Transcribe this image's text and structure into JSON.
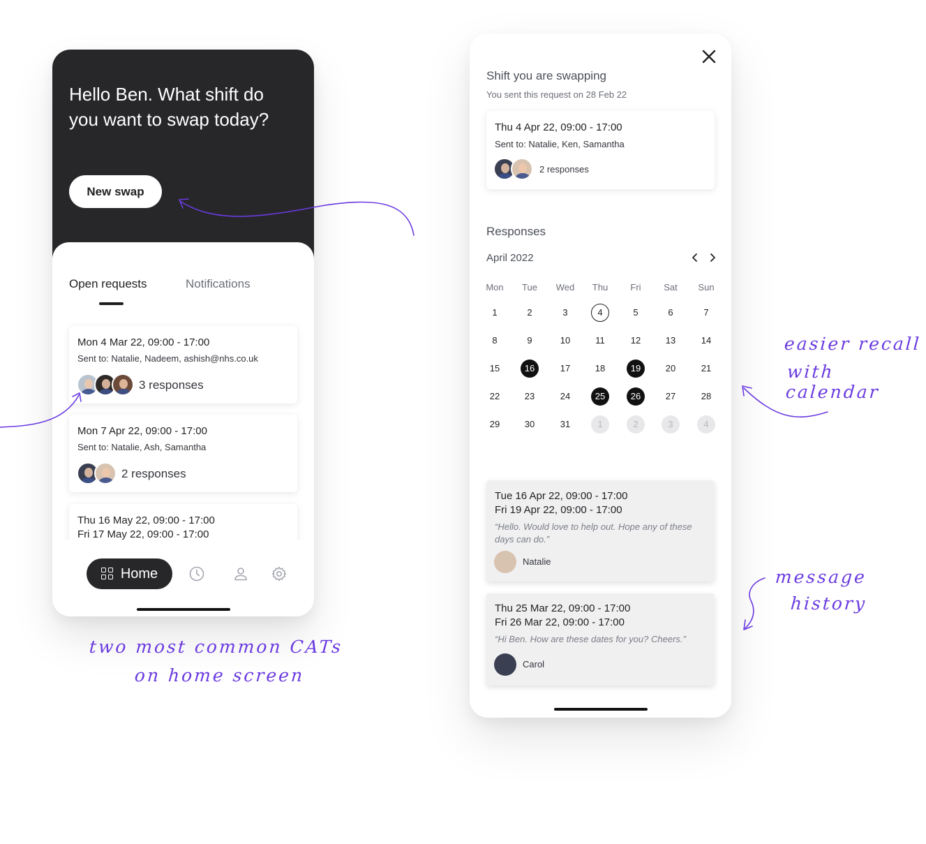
{
  "home_screen": {
    "greeting": "Hello Ben. What shift do you want to swap today?",
    "new_swap_label": "New swap",
    "tabs": [
      {
        "label": "Open requests",
        "active": true
      },
      {
        "label": "Notifications",
        "active": false
      }
    ],
    "requests": [
      {
        "dates": "Mon 4 Mar 22, 09:00 - 17:00",
        "sent_to": "Sent to: Natalie, Nadeem, ashish@nhs.co.uk",
        "responses": "3 responses"
      },
      {
        "dates": "Mon 7 Apr 22, 09:00 - 17:00",
        "sent_to": "Sent to: Natalie, Ash, Samantha",
        "responses": "2 responses"
      },
      {
        "dates_line1": "Thu 16 May 22, 09:00 - 17:00",
        "dates_line2": "Fri 17 May 22, 09:00 - 17:00"
      }
    ],
    "tabbar": {
      "home_label": "Home",
      "icons": [
        "grid-icon",
        "clock-icon",
        "profile-icon",
        "gear-icon"
      ]
    }
  },
  "detail_screen": {
    "title": "Shift you are swapping",
    "subtitle": "You sent this request on 28 Feb 22",
    "swap": {
      "dates": "Thu 4 Apr 22, 09:00 - 17:00",
      "sent_to": "Sent to: Natalie, Ken, Samantha",
      "responses": "2 responses"
    },
    "responses_title": "Responses",
    "calendar": {
      "month": "April 2022",
      "weekdays": [
        "Mon",
        "Tue",
        "Wed",
        "Thu",
        "Fri",
        "Sat",
        "Sun"
      ],
      "weeks": [
        [
          "1",
          "2",
          "3",
          "4",
          "5",
          "6",
          "7"
        ],
        [
          "8",
          "9",
          "10",
          "11",
          "12",
          "13",
          "14"
        ],
        [
          "15",
          "16",
          "17",
          "18",
          "19",
          "20",
          "21"
        ],
        [
          "22",
          "23",
          "24",
          "25",
          "26",
          "27",
          "28"
        ],
        [
          "29",
          "30",
          "31",
          "1",
          "2",
          "3",
          "4"
        ]
      ],
      "outlined_day": "4",
      "selected_days": [
        "16",
        "19",
        "25",
        "26"
      ],
      "faded_days": [
        "1",
        "2",
        "3",
        "4"
      ]
    },
    "messages": [
      {
        "line1": "Tue 16 Apr 22, 09:00 - 17:00",
        "line2": "Fri 19 Apr 22, 09:00 - 17:00",
        "quote": "“Hello. Would love to help out. Hope any of these days can do.”",
        "name": "Natalie"
      },
      {
        "line1": "Thu 25 Mar 22, 09:00 - 17:00",
        "line2": "Fri 26 Mar 22, 09:00 - 17:00",
        "quote": "“Hi Ben. How are these dates for you? Cheers.”",
        "name": "Carol"
      }
    ]
  },
  "annotations": {
    "calendar_note_line1": "easier recall",
    "calendar_note_line2": "with calendar",
    "message_note_line1": "message",
    "message_note_line2": "history",
    "home_note_line1": "two most common CATs",
    "home_note_line2": "on home screen"
  },
  "colors": {
    "annotation": "#6a3be0",
    "dark": "#27272a",
    "selected_day": "#111111"
  }
}
